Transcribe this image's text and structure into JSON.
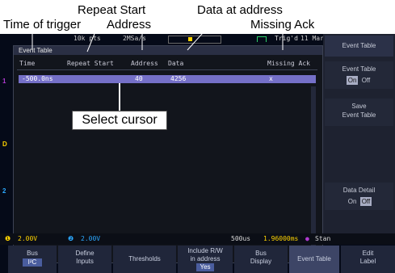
{
  "callouts": {
    "repeat_start": "Repeat Start",
    "data_at_address": "Data at address",
    "time_of_trigger": "Time of trigger",
    "address": "Address",
    "missing_ack": "Missing Ack",
    "select_cursor": "Select cursor"
  },
  "top_status": {
    "record": "10k pts",
    "sample_rate": "2MSa/s",
    "trigger": "Trig'd",
    "date": "11 Mar"
  },
  "event_table": {
    "title": "Event Table",
    "columns": [
      "Time",
      "Repeat Start",
      "Address",
      "Data",
      "Missing Ack"
    ],
    "rows": [
      {
        "time": "-500.0ns",
        "repeat_start": "",
        "address": "40",
        "data": "4256",
        "missing_ack": "x"
      }
    ]
  },
  "soft_menu": {
    "title": "Event Table",
    "event_table_toggle": {
      "label": "Event Table",
      "on": "On",
      "off": "Off",
      "state": "On"
    },
    "save": {
      "label1": "Save",
      "label2": "Event Table"
    },
    "data_detail": {
      "label": "Data Detail",
      "on": "On",
      "off": "Off",
      "state": "Off"
    }
  },
  "channel_markers": {
    "ch1": "1",
    "ch3": "D",
    "ch2": "2"
  },
  "bottom_status": {
    "ch1_scale": "2.00V",
    "ch2_scale": "2.00V",
    "timebase": "500us",
    "freq": "1.96000ms",
    "mode": "Stan"
  },
  "bottom_menu": [
    {
      "line1": "Bus",
      "line2": "I²C",
      "highlight": true
    },
    {
      "line1": "Define",
      "line2": "Inputs"
    },
    {
      "line1": "Thresholds",
      "line2": ""
    },
    {
      "line1": "Include R/W",
      "line2": "in address",
      "line3": "Yes"
    },
    {
      "line1": "Bus",
      "line2": "Display"
    },
    {
      "line1": "Event Table",
      "line2": ""
    },
    {
      "line1": "Edit",
      "line2": "Label"
    }
  ],
  "colors": {
    "ch1": "#ffd400",
    "ch2": "#2ba8ff",
    "ch3": "#b03ad0",
    "row_highlight": "#7570c8"
  }
}
